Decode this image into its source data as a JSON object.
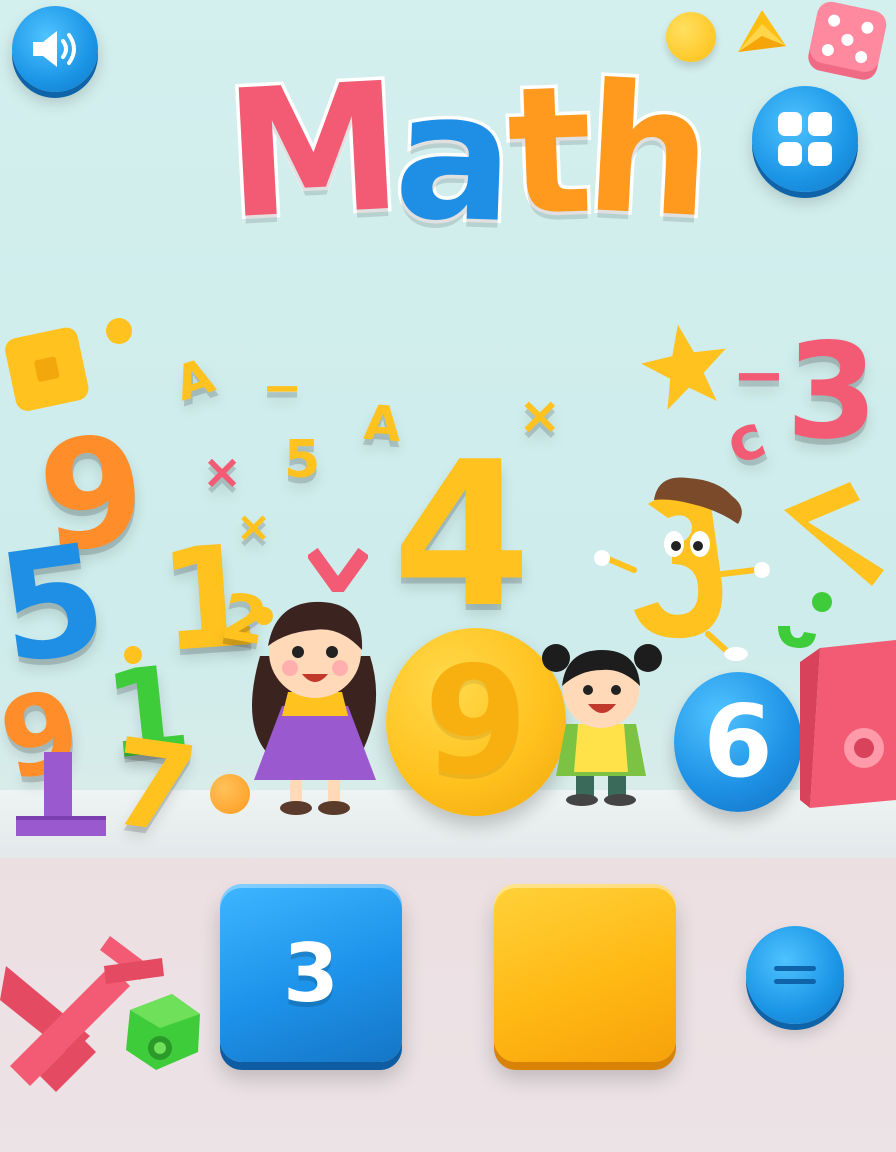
{
  "title": {
    "letters": [
      {
        "char": "M",
        "color": "#f25b73"
      },
      {
        "char": "a",
        "color": "#1f8fe5"
      },
      {
        "char": "t",
        "color": "#ff9a1e"
      },
      {
        "char": "h",
        "color": "#ff9a1e"
      }
    ]
  },
  "buttons": {
    "sound_icon": "speaker-icon",
    "menu_icon": "grid-icon",
    "equals_icon": "equals-icon"
  },
  "puzzle": {
    "given_number": "3",
    "answer_value": ""
  },
  "decor": {
    "numbers": [
      "9",
      "5",
      "1",
      "4",
      "9",
      "6",
      "3",
      "7",
      "1",
      "2"
    ],
    "symbols": [
      "A",
      "A",
      "5",
      "×",
      "×",
      "×",
      "−",
      "−",
      "c"
    ]
  },
  "colors": {
    "sky": "#d3efee",
    "blue": "#1f8fe5",
    "yellow": "#ffc21f",
    "red": "#f25b73",
    "orange": "#ff9a1e",
    "green": "#3fcc3a",
    "purple": "#9b59d0"
  }
}
